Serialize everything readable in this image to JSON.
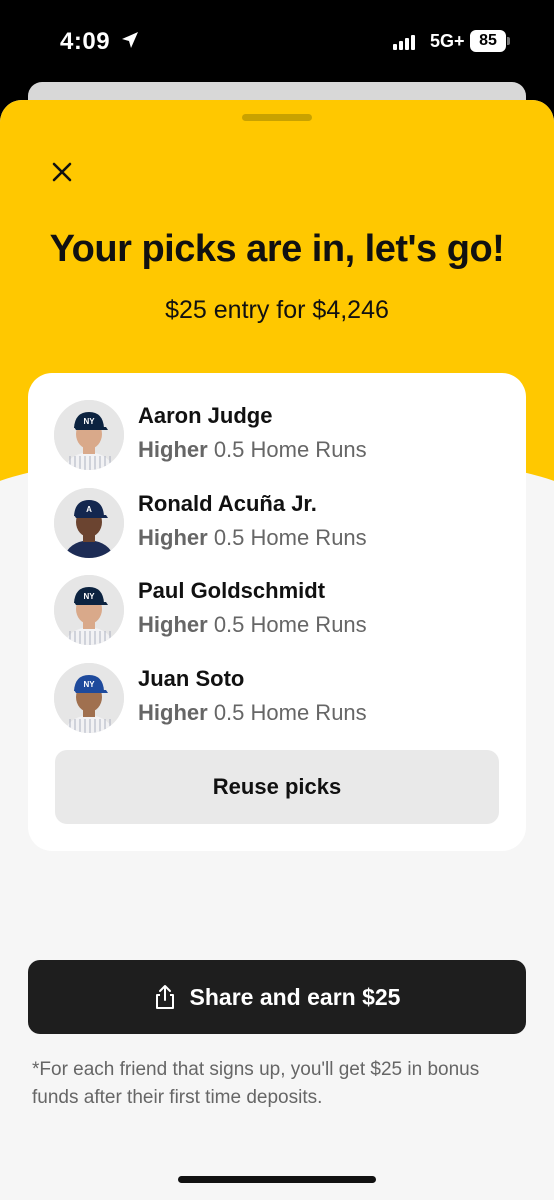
{
  "status_bar": {
    "time": "4:09",
    "network": "5G+",
    "battery": "85"
  },
  "header": {
    "title": "Your picks are in, let's go!",
    "entry_summary": "$25 entry for $4,246",
    "accent_color": "#ffc800"
  },
  "picks": [
    {
      "name": "Aaron Judge",
      "direction": "Higher",
      "line": "0.5 Home Runs",
      "cap_color": "#0c2340",
      "cap_mark": "NY",
      "jersey": "pinstripes"
    },
    {
      "name": "Ronald Acuña Jr.",
      "direction": "Higher",
      "line": "0.5 Home Runs",
      "cap_color": "#13274f",
      "cap_mark": "A",
      "jersey": "navy"
    },
    {
      "name": "Paul Goldschmidt",
      "direction": "Higher",
      "line": "0.5 Home Runs",
      "cap_color": "#0c2340",
      "cap_mark": "NY",
      "jersey": "pinstripes"
    },
    {
      "name": "Juan Soto",
      "direction": "Higher",
      "line": "0.5 Home Runs",
      "cap_color": "#1e4a9c",
      "cap_mark": "NY",
      "jersey": "pinstripes"
    }
  ],
  "actions": {
    "reuse_label": "Reuse picks",
    "share_label": "Share and earn $25"
  },
  "disclaimer": "*For each friend that signs up, you'll get $25 in bonus funds after their first time deposits.",
  "icons": {
    "close": "close-icon",
    "share": "share-icon",
    "location": "location-arrow-icon"
  }
}
